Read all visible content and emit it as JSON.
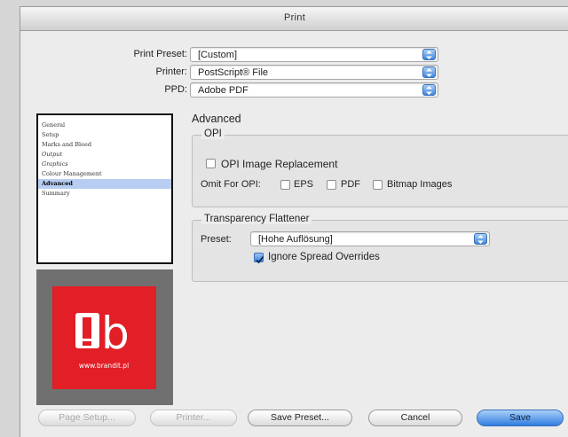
{
  "window": {
    "title": "Print"
  },
  "preset_rows": [
    {
      "label": "Print Preset:",
      "value": "[Custom]"
    },
    {
      "label": "Printer:",
      "value": "PostScript® File"
    },
    {
      "label": "PPD:",
      "value": "Adobe PDF"
    }
  ],
  "sidebar": {
    "items": [
      {
        "label": "General",
        "selected": false
      },
      {
        "label": "Setup",
        "selected": false
      },
      {
        "label": "Marks and Bleed",
        "selected": false
      },
      {
        "label": "Output",
        "selected": false
      },
      {
        "label": "Graphics",
        "selected": false
      },
      {
        "label": "Colour Management",
        "selected": false
      },
      {
        "label": "Advanced",
        "selected": true
      },
      {
        "label": "Summary",
        "selected": false
      }
    ]
  },
  "logo": {
    "mark": "!b",
    "site": "www.brandit.pl",
    "color": "#e21e26"
  },
  "panel": {
    "title": "Advanced",
    "opi": {
      "label": "OPI",
      "image_replacement": {
        "label": "OPI Image Replacement",
        "checked": false
      },
      "omit_label": "Omit For OPI:",
      "omit": [
        {
          "label": "EPS",
          "checked": false
        },
        {
          "label": "PDF",
          "checked": false
        },
        {
          "label": "Bitmap Images",
          "checked": false
        }
      ]
    },
    "flattener": {
      "label": "Transparency Flattener",
      "preset_label": "Preset:",
      "preset_value": "[Hohe Auflösung]",
      "ignore_overrides": {
        "label": "Ignore Spread Overrides",
        "checked": true
      }
    }
  },
  "buttons": {
    "page_setup": "Page Setup...",
    "printer": "Printer...",
    "save_preset": "Save Preset...",
    "cancel": "Cancel",
    "save": "Save"
  },
  "accent_color": "#3f87e0"
}
